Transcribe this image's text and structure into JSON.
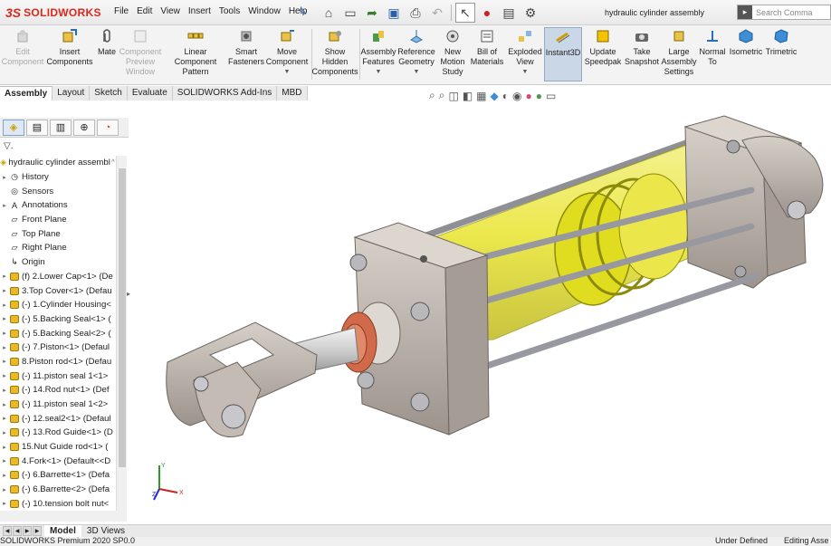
{
  "app": {
    "brand_mark": "3S",
    "brand_name": "SOLIDWORKS"
  },
  "menu": [
    "File",
    "Edit",
    "View",
    "Insert",
    "Tools",
    "Window",
    "Help"
  ],
  "document_title": "hydraulic cylinder assembly",
  "search": {
    "placeholder": "Search Comma"
  },
  "ribbon": {
    "edit_component": "Edit Component",
    "insert_components": "Insert Components",
    "mate": "Mate",
    "component_preview": "Component Preview Window",
    "linear_pattern": "Linear Component Pattern",
    "smart_fasteners": "Smart Fasteners",
    "move_component": "Move Component",
    "show_hidden": "Show Hidden Components",
    "assembly_features": "Assembly Features",
    "reference_geometry": "Reference Geometry",
    "new_motion_study": "New Motion Study",
    "bill_of_materials": "Bill of Materials",
    "exploded_view": "Exploded View",
    "instant3d": "Instant3D",
    "update_speedpak": "Update Speedpak",
    "take_snapshot": "Take Snapshot",
    "large_assembly": "Large Assembly Settings",
    "normal_to": "Normal To",
    "isometric": "Isometric",
    "trimetric": "Trimetric"
  },
  "command_tabs": [
    "Assembly",
    "Layout",
    "Sketch",
    "Evaluate",
    "SOLIDWORKS Add-Ins",
    "MBD"
  ],
  "tree": {
    "root": "hydraulic cylinder assembl",
    "filter_glyph": "▽.",
    "items": [
      {
        "label": "History",
        "icon": "history-icon"
      },
      {
        "label": "Sensors",
        "icon": "sensors-icon"
      },
      {
        "label": "Annotations",
        "icon": "annotations-icon"
      },
      {
        "label": "Front Plane",
        "icon": "plane-icon"
      },
      {
        "label": "Top Plane",
        "icon": "plane-icon"
      },
      {
        "label": "Right Plane",
        "icon": "plane-icon"
      },
      {
        "label": "Origin",
        "icon": "origin-icon"
      },
      {
        "label": "(f) 2.Lower Cap<1> (De",
        "icon": "part-icon"
      },
      {
        "label": "3.Top Cover<1> (Defau",
        "icon": "part-icon"
      },
      {
        "label": "(-) 1.Cylinder Housing<",
        "icon": "part-icon"
      },
      {
        "label": "(-) 5.Backing Seal<1> (",
        "icon": "part-icon"
      },
      {
        "label": "(-) 5.Backing Seal<2> (",
        "icon": "part-icon"
      },
      {
        "label": "(-) 7.Piston<1> (Defaul",
        "icon": "part-icon"
      },
      {
        "label": "8.Piston rod<1> (Defau",
        "icon": "part-icon"
      },
      {
        "label": "(-) 11.piston seal 1<1>",
        "icon": "part-icon"
      },
      {
        "label": "(-) 14.Rod nut<1> (Def",
        "icon": "part-icon"
      },
      {
        "label": "(-) 11.piston seal 1<2>",
        "icon": "part-icon"
      },
      {
        "label": "(-) 12.seal2<1> (Defaul",
        "icon": "part-icon"
      },
      {
        "label": "(-) 13.Rod Guide<1> (D",
        "icon": "part-icon"
      },
      {
        "label": "15.Nut Guide rod<1> (",
        "icon": "part-icon"
      },
      {
        "label": "4.Fork<1> (Default<<D",
        "icon": "part-icon"
      },
      {
        "label": "(-) 6.Barrette<1> (Defa",
        "icon": "part-icon"
      },
      {
        "label": "(-) 6.Barrette<2> (Defa",
        "icon": "part-icon"
      },
      {
        "label": "(-) 10.tension bolt nut<",
        "icon": "part-icon"
      }
    ]
  },
  "bottom_tabs": [
    "Model",
    "3D Views"
  ],
  "status": {
    "left": "SOLIDWORKS Premium 2020 SP0.0",
    "definition": "Under Defined",
    "mode": "Editing Asse"
  },
  "triad": {
    "x": "X",
    "y": "Y",
    "z": "Z"
  },
  "colors": {
    "brand": "#da291c",
    "cylinder_glass": "#e6e21a",
    "steel": "#bdb5ad",
    "rod_nut": "#d06a4a"
  }
}
